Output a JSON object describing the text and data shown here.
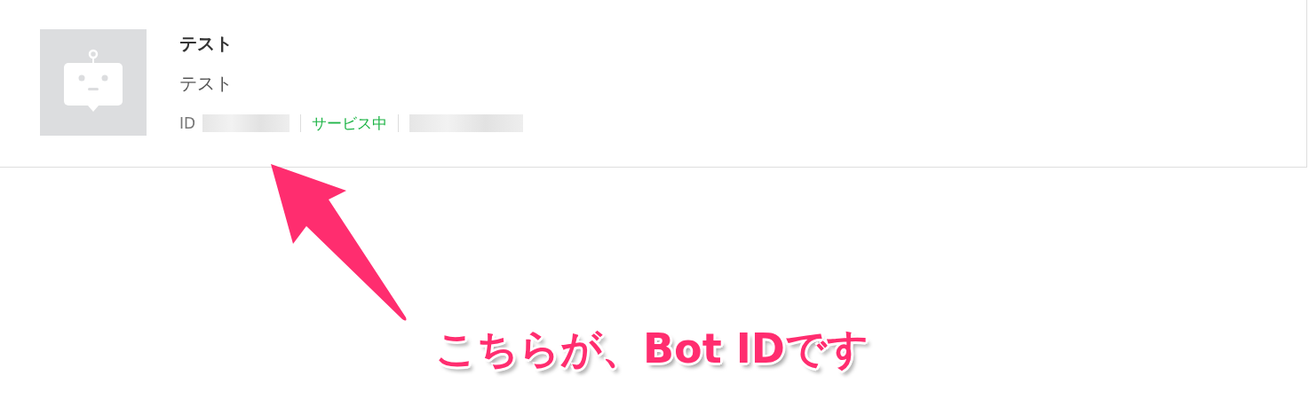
{
  "bot": {
    "name": "テスト",
    "description": "テスト",
    "id_label": "ID",
    "status": "サービス中"
  },
  "annotation": {
    "text": "こちらが、Bot IDです"
  }
}
